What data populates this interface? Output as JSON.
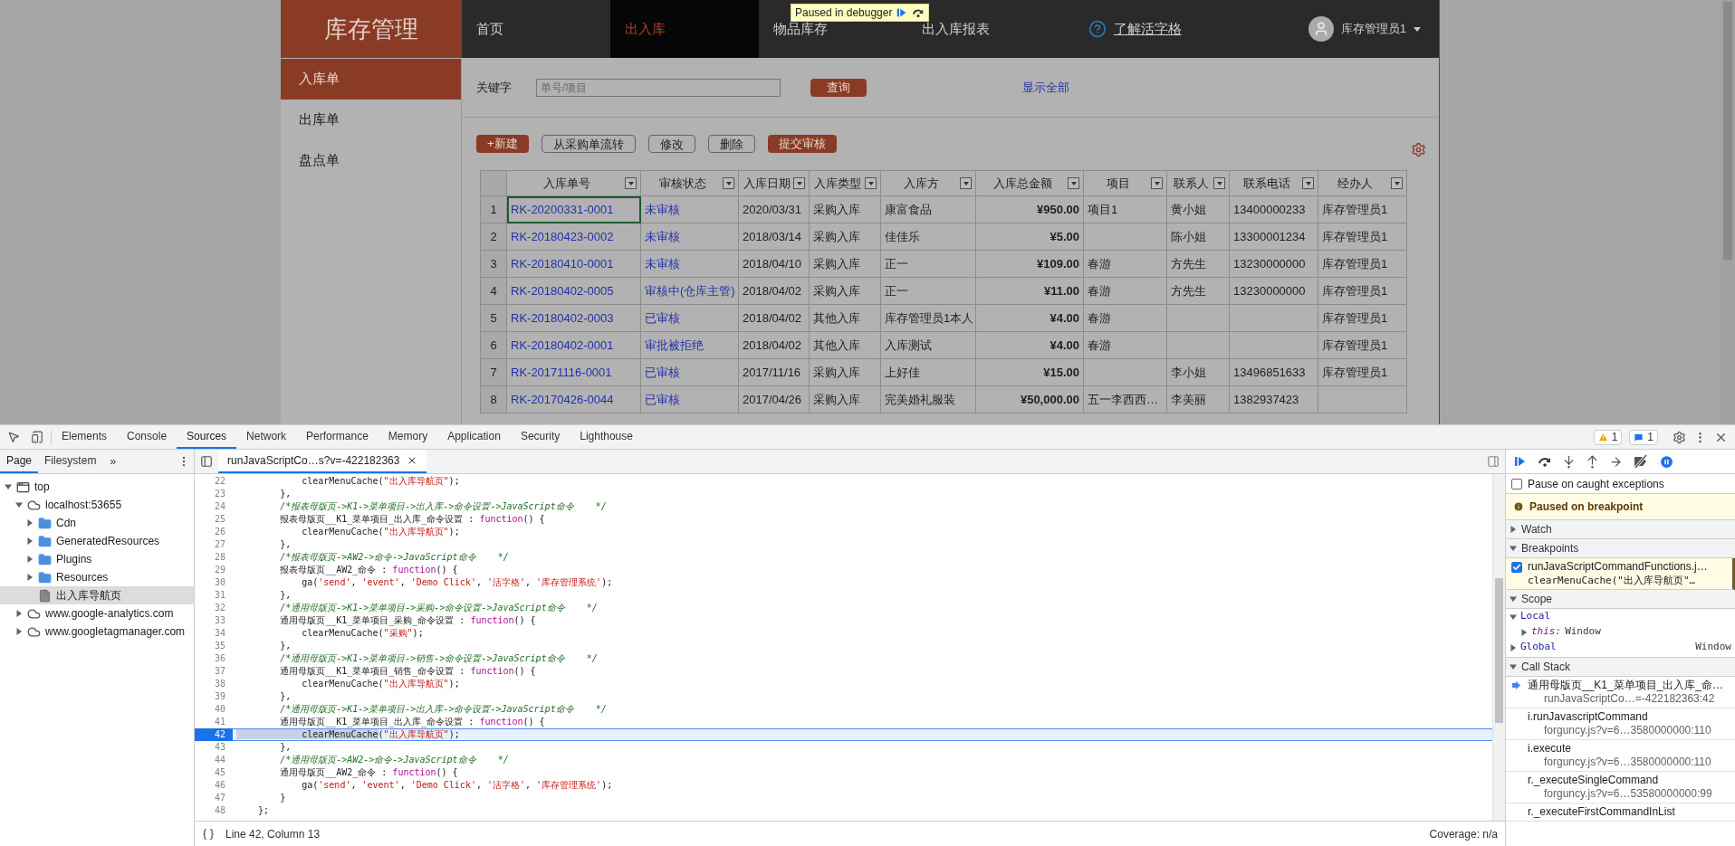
{
  "page": {
    "logo": "库存管理",
    "nav": [
      {
        "label": "首页",
        "selected": false
      },
      {
        "label": "出入库",
        "selected": true
      },
      {
        "label": "物品库存",
        "selected": false
      },
      {
        "label": "出入库报表",
        "selected": false
      }
    ],
    "help_link": "了解活字格",
    "user": "库存管理员1",
    "debugger_banner": "Paused in debugger",
    "sidebar": [
      {
        "label": "入库单",
        "selected": true
      },
      {
        "label": "出库单",
        "selected": false
      },
      {
        "label": "盘点单",
        "selected": false
      }
    ],
    "search": {
      "label": "关键字",
      "placeholder": "单号/项目",
      "button": "查询",
      "show_all": "显示全部"
    },
    "toolbar": [
      {
        "label": "+新建",
        "kind": "primary"
      },
      {
        "label": "从采购单流转",
        "kind": "outline"
      },
      {
        "label": "修改",
        "kind": "outline"
      },
      {
        "label": "删除",
        "kind": "outline"
      },
      {
        "label": "提交审核",
        "kind": "primary"
      }
    ],
    "table": {
      "columns": [
        {
          "label": "入库单号",
          "kind": "link"
        },
        {
          "label": "审核状态",
          "kind": "link"
        },
        {
          "label": "入库日期",
          "kind": "text"
        },
        {
          "label": "入库类型",
          "kind": "text"
        },
        {
          "label": "入库方",
          "kind": "text"
        },
        {
          "label": "入库总金额",
          "kind": "amount"
        },
        {
          "label": "项目",
          "kind": "text"
        },
        {
          "label": "联系人",
          "kind": "text"
        },
        {
          "label": "联系电话",
          "kind": "text"
        },
        {
          "label": "经办人",
          "kind": "text"
        }
      ],
      "rows": [
        {
          "number": "1",
          "focused": true,
          "cells": [
            "RK-20200331-0001",
            "未审核",
            "2020/03/31",
            "采购入库",
            "康富食品",
            "¥950.00",
            "项目1",
            "黄小姐",
            "13400000233",
            "库存管理员1"
          ]
        },
        {
          "number": "2",
          "focused": false,
          "cells": [
            "RK-20180423-0002",
            "未审核",
            "2018/03/14",
            "采购入库",
            "佳佳乐",
            "¥5.00",
            null,
            "陈小姐",
            "13300001234",
            "库存管理员1"
          ]
        },
        {
          "number": "3",
          "focused": false,
          "cells": [
            "RK-20180410-0001",
            "未审核",
            "2018/04/10",
            "采购入库",
            "正一",
            "¥109.00",
            "春游",
            "方先生",
            "13230000000",
            "库存管理员1"
          ]
        },
        {
          "number": "4",
          "focused": false,
          "cells": [
            "RK-20180402-0005",
            "审核中(仓库主管)",
            "2018/04/02",
            "采购入库",
            "正一",
            "¥11.00",
            "春游",
            "方先生",
            "13230000000",
            "库存管理员1"
          ]
        },
        {
          "number": "5",
          "focused": false,
          "cells": [
            "RK-20180402-0003",
            "已审核",
            "2018/04/02",
            "其他入库",
            "库存管理员1本人",
            "¥4.00",
            "春游",
            null,
            null,
            "库存管理员1"
          ]
        },
        {
          "number": "6",
          "focused": false,
          "cells": [
            "RK-20180402-0001",
            "审批被拒绝",
            "2018/04/02",
            "其他入库",
            "入库测试",
            "¥4.00",
            "春游",
            null,
            null,
            "库存管理员1"
          ]
        },
        {
          "number": "7",
          "focused": false,
          "cells": [
            "RK-20171116-0001",
            "已审核",
            "2017/11/16",
            "采购入库",
            "上好佳",
            "¥15.00",
            null,
            "李小姐",
            "13496851633",
            "库存管理员1"
          ]
        },
        {
          "number": "8",
          "focused": false,
          "cells": [
            "RK-20170426-0044",
            "已审核",
            "2017/04/26",
            "采购入库",
            "完美婚礼服装",
            "¥50,000.00",
            "五一李西西…",
            "李美丽",
            "1382937423",
            null
          ]
        }
      ]
    }
  },
  "devtools": {
    "tabs": [
      {
        "label": "Elements",
        "selected": false
      },
      {
        "label": "Console",
        "selected": false
      },
      {
        "label": "Sources",
        "selected": true
      },
      {
        "label": "Network",
        "selected": false
      },
      {
        "label": "Performance",
        "selected": false
      },
      {
        "label": "Memory",
        "selected": false
      },
      {
        "label": "Application",
        "selected": false
      },
      {
        "label": "Security",
        "selected": false
      },
      {
        "label": "Lighthouse",
        "selected": false
      }
    ],
    "warnings": "1",
    "messages": "1",
    "navigator": {
      "tabs": [
        {
          "label": "Page",
          "selected": true
        },
        {
          "label": "Filesystem",
          "selected": false
        }
      ],
      "more": "»",
      "tree": [
        {
          "label": "top",
          "kind": "frame",
          "expanded": true,
          "selected": false,
          "children": [
            {
              "label": "localhost:53655",
              "kind": "origin",
              "expanded": true,
              "selected": false,
              "children": [
                {
                  "label": "Cdn",
                  "kind": "folder",
                  "expanded": false,
                  "selected": false
                },
                {
                  "label": "GeneratedResources",
                  "kind": "folder",
                  "expanded": false,
                  "selected": false
                },
                {
                  "label": "Plugins",
                  "kind": "folder",
                  "expanded": false,
                  "selected": false
                },
                {
                  "label": "Resources",
                  "kind": "folder",
                  "expanded": false,
                  "selected": false
                },
                {
                  "label": "出入库导航页",
                  "kind": "file",
                  "selected": true
                }
              ]
            },
            {
              "label": "www.google-analytics.com",
              "kind": "origin",
              "expanded": false,
              "selected": false
            },
            {
              "label": "www.googletagmanager.com",
              "kind": "origin",
              "expanded": false,
              "selected": false
            }
          ]
        }
      ]
    },
    "editor": {
      "file_tab": "runJavaScriptCo…s?v=-422182363",
      "lines": [
        {
          "number": "22",
          "current": false,
          "segments": [
            {
              "kind": "plain",
              "text": "            clearMenuCache("
            },
            {
              "kind": "string",
              "text": "\"出入库导航页\""
            },
            {
              "kind": "plain",
              "text": ");"
            }
          ]
        },
        {
          "number": "23",
          "current": false,
          "segments": [
            {
              "kind": "plain",
              "text": "        },"
            }
          ]
        },
        {
          "number": "24",
          "current": false,
          "segments": [
            {
              "kind": "comment",
              "text": "        /*报表母版页->K1->菜单项目->出入库->命令设置->JavaScript命令    */"
            }
          ]
        },
        {
          "number": "25",
          "current": false,
          "segments": [
            {
              "kind": "plain",
              "text": "        报表母版页__K1_菜单项目_出入库_命令设置 : "
            },
            {
              "kind": "keyword",
              "text": "function"
            },
            {
              "kind": "plain",
              "text": "() {"
            }
          ]
        },
        {
          "number": "26",
          "current": false,
          "segments": [
            {
              "kind": "plain",
              "text": "            clearMenuCache("
            },
            {
              "kind": "string",
              "text": "\"出入库导航页\""
            },
            {
              "kind": "plain",
              "text": ");"
            }
          ]
        },
        {
          "number": "27",
          "current": false,
          "segments": [
            {
              "kind": "plain",
              "text": "        },"
            }
          ]
        },
        {
          "number": "28",
          "current": false,
          "segments": [
            {
              "kind": "comment",
              "text": "        /*报表母版页->AW2->命令->JavaScript命令    */"
            }
          ]
        },
        {
          "number": "29",
          "current": false,
          "segments": [
            {
              "kind": "plain",
              "text": "        报表母版页__AW2_命令 : "
            },
            {
              "kind": "keyword",
              "text": "function"
            },
            {
              "kind": "plain",
              "text": "() {"
            }
          ]
        },
        {
          "number": "30",
          "current": false,
          "segments": [
            {
              "kind": "plain",
              "text": "            ga("
            },
            {
              "kind": "string",
              "text": "'send'"
            },
            {
              "kind": "plain",
              "text": ", "
            },
            {
              "kind": "string",
              "text": "'event'"
            },
            {
              "kind": "plain",
              "text": ", "
            },
            {
              "kind": "string",
              "text": "'Demo Click'"
            },
            {
              "kind": "plain",
              "text": ", "
            },
            {
              "kind": "string",
              "text": "'活字格'"
            },
            {
              "kind": "plain",
              "text": ", "
            },
            {
              "kind": "string",
              "text": "'库存管理系统'"
            },
            {
              "kind": "plain",
              "text": ");"
            }
          ]
        },
        {
          "number": "31",
          "current": false,
          "segments": [
            {
              "kind": "plain",
              "text": "        },"
            }
          ]
        },
        {
          "number": "32",
          "current": false,
          "segments": [
            {
              "kind": "comment",
              "text": "        /*通用母版页->K1->菜单项目->采购->命令设置->JavaScript命令    */"
            }
          ]
        },
        {
          "number": "33",
          "current": false,
          "segments": [
            {
              "kind": "plain",
              "text": "        通用母版页__K1_菜单项目_采购_命令设置 : "
            },
            {
              "kind": "keyword",
              "text": "function"
            },
            {
              "kind": "plain",
              "text": "() {"
            }
          ]
        },
        {
          "number": "34",
          "current": false,
          "segments": [
            {
              "kind": "plain",
              "text": "            clearMenuCache("
            },
            {
              "kind": "string",
              "text": "\"采购\""
            },
            {
              "kind": "plain",
              "text": ");"
            }
          ]
        },
        {
          "number": "35",
          "current": false,
          "segments": [
            {
              "kind": "plain",
              "text": "        },"
            }
          ]
        },
        {
          "number": "36",
          "current": false,
          "segments": [
            {
              "kind": "comment",
              "text": "        /*通用母版页->K1->菜单项目->销售->命令设置->JavaScript命令    */"
            }
          ]
        },
        {
          "number": "37",
          "current": false,
          "segments": [
            {
              "kind": "plain",
              "text": "        通用母版页__K1_菜单项目_销售_命令设置 : "
            },
            {
              "kind": "keyword",
              "text": "function"
            },
            {
              "kind": "plain",
              "text": "() {"
            }
          ]
        },
        {
          "number": "38",
          "current": false,
          "segments": [
            {
              "kind": "plain",
              "text": "            clearMenuCache("
            },
            {
              "kind": "string",
              "text": "\"出入库导航页\""
            },
            {
              "kind": "plain",
              "text": ");"
            }
          ]
        },
        {
          "number": "39",
          "current": false,
          "segments": [
            {
              "kind": "plain",
              "text": "        },"
            }
          ]
        },
        {
          "number": "40",
          "current": false,
          "segments": [
            {
              "kind": "comment",
              "text": "        /*通用母版页->K1->菜单项目->出入库->命令设置->JavaScript命令    */"
            }
          ]
        },
        {
          "number": "41",
          "current": false,
          "segments": [
            {
              "kind": "plain",
              "text": "        通用母版页__K1_菜单项目_出入库_命令设置 : "
            },
            {
              "kind": "keyword",
              "text": "function"
            },
            {
              "kind": "plain",
              "text": "() {"
            }
          ]
        },
        {
          "number": "42",
          "current": true,
          "segments": [
            {
              "kind": "selection",
              "text": "            clearMenuCache"
            },
            {
              "kind": "plain",
              "text": "("
            },
            {
              "kind": "string",
              "text": "\"出入库导航页\""
            },
            {
              "kind": "plain",
              "text": ");"
            }
          ]
        },
        {
          "number": "43",
          "current": false,
          "segments": [
            {
              "kind": "plain",
              "text": "        },"
            }
          ]
        },
        {
          "number": "44",
          "current": false,
          "segments": [
            {
              "kind": "comment",
              "text": "        /*通用母版页->AW2->命令->JavaScript命令    */"
            }
          ]
        },
        {
          "number": "45",
          "current": false,
          "segments": [
            {
              "kind": "plain",
              "text": "        通用母版页__AW2_命令 : "
            },
            {
              "kind": "keyword",
              "text": "function"
            },
            {
              "kind": "plain",
              "text": "() {"
            }
          ]
        },
        {
          "number": "46",
          "current": false,
          "segments": [
            {
              "kind": "plain",
              "text": "            ga("
            },
            {
              "kind": "string",
              "text": "'send'"
            },
            {
              "kind": "plain",
              "text": ", "
            },
            {
              "kind": "string",
              "text": "'event'"
            },
            {
              "kind": "plain",
              "text": ", "
            },
            {
              "kind": "string",
              "text": "'Demo Click'"
            },
            {
              "kind": "plain",
              "text": ", "
            },
            {
              "kind": "string",
              "text": "'活字格'"
            },
            {
              "kind": "plain",
              "text": ", "
            },
            {
              "kind": "string",
              "text": "'库存管理系统'"
            },
            {
              "kind": "plain",
              "text": ");"
            }
          ]
        },
        {
          "number": "47",
          "current": false,
          "segments": [
            {
              "kind": "plain",
              "text": "        }"
            }
          ]
        },
        {
          "number": "48",
          "current": false,
          "segments": [
            {
              "kind": "plain",
              "text": "    };"
            }
          ]
        }
      ],
      "status": "Line 42, Column 13",
      "coverage": "Coverage: n/a"
    },
    "debugger": {
      "pause_on_caught": {
        "label": "Pause on caught exceptions",
        "checked": false
      },
      "paused_message": "Paused on breakpoint",
      "watch": {
        "title": "Watch",
        "expanded": false
      },
      "breakpoints": {
        "title": "Breakpoints",
        "expanded": true,
        "items": [
          {
            "file": "runJavaScriptCommandFunctions.j…",
            "code": "clearMenuCache(\"出入库导航页\"…",
            "checked": true
          }
        ]
      },
      "scope": {
        "title": "Scope",
        "expanded": true,
        "local": {
          "label": "Local",
          "expanded": true,
          "entries": [
            {
              "name": "this:",
              "value": "Window",
              "expanded": false
            }
          ]
        },
        "global": {
          "label": "Global",
          "value": "Window",
          "expanded": false
        }
      },
      "call_stack": {
        "title": "Call Stack",
        "expanded": true,
        "frames": [
          {
            "function": "通用母版页__K1_菜单项目_出入库_命…",
            "location": "runJavaScriptCo…=-422182363:42",
            "selected": true
          },
          {
            "function": "i.runJavascriptCommand",
            "location": "forguncy.js?v=6…3580000000:110",
            "selected": false
          },
          {
            "function": "i.execute",
            "location": "forguncy.js?v=6…3580000000:110",
            "selected": false
          },
          {
            "function": "r._executeSingleCommand",
            "location": "forguncy.js?v=6…53580000000:99",
            "selected": false
          },
          {
            "function": "r._executeFirstCommandInList",
            "selected": false
          }
        ]
      }
    }
  }
}
